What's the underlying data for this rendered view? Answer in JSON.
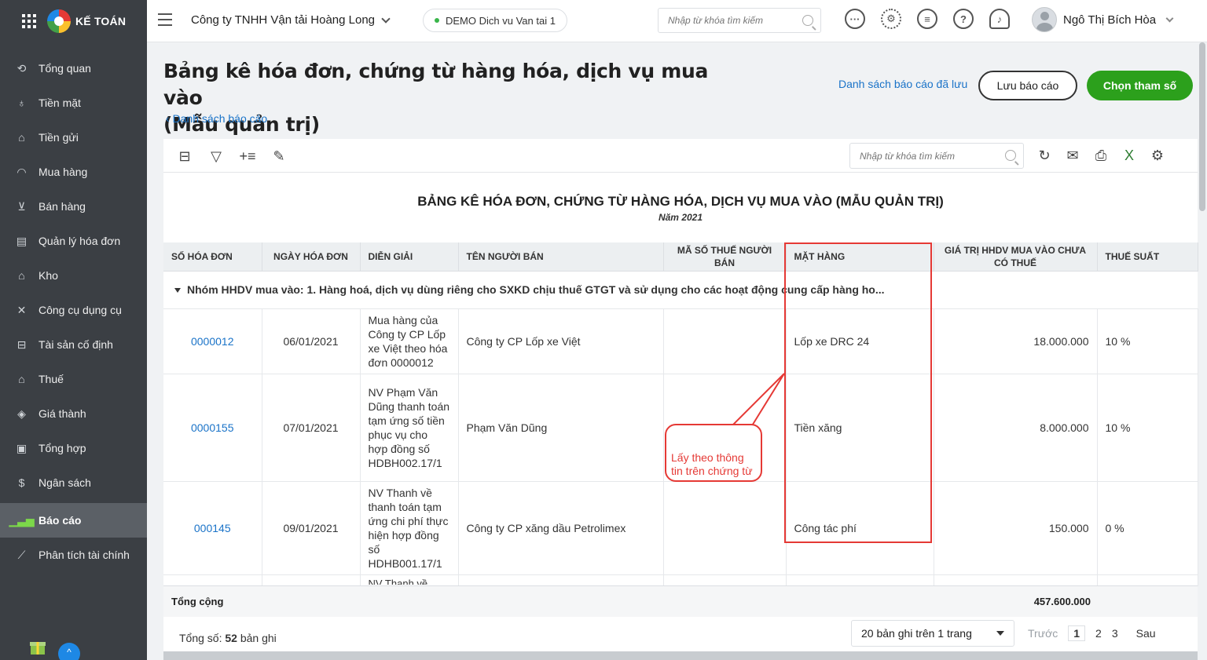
{
  "brand": {
    "name": "KẾ TOÁN"
  },
  "sidebar": {
    "items": [
      {
        "label": "Tổng quan",
        "icon": "dashboard-icon"
      },
      {
        "label": "Tiền mặt",
        "icon": "cash-icon"
      },
      {
        "label": "Tiền gửi",
        "icon": "bank-icon"
      },
      {
        "label": "Mua hàng",
        "icon": "bag-icon"
      },
      {
        "label": "Bán hàng",
        "icon": "cart-icon"
      },
      {
        "label": "Quản lý hóa đơn",
        "icon": "invoice-icon"
      },
      {
        "label": "Kho",
        "icon": "warehouse-icon"
      },
      {
        "label": "Công cụ dụng cụ",
        "icon": "tools-icon"
      },
      {
        "label": "Tài sản cố định",
        "icon": "asset-icon"
      },
      {
        "label": "Thuế",
        "icon": "tax-icon"
      },
      {
        "label": "Giá thành",
        "icon": "price-tag-icon"
      },
      {
        "label": "Tổng hợp",
        "icon": "summary-icon"
      },
      {
        "label": "Ngân sách",
        "icon": "budget-icon"
      },
      {
        "label": "Báo cáo",
        "icon": "report-bar-icon",
        "active": true
      },
      {
        "label": "Phân tích tài chính",
        "icon": "analysis-icon"
      }
    ]
  },
  "topbar": {
    "company": "Công ty TNHH Vận tải Hoàng Long",
    "demo": "DEMO Dich vu Van tai 1",
    "search_placeholder": "Nhập từ khóa tìm kiếm",
    "user": "Ngô Thị Bích Hòa"
  },
  "page": {
    "title_line1": "Bảng kê hóa đơn, chứng từ hàng hóa, dịch vụ mua vào",
    "title_line2": "(Mẫu quản trị)",
    "back_link": "Danh sách báo cáo",
    "saved_link": "Danh sách báo cáo đã lưu",
    "save_button": "Lưu báo cáo",
    "param_button": "Chọn tham số"
  },
  "toolbar": {
    "search_placeholder": "Nhập từ khóa tìm kiếm"
  },
  "report": {
    "title": "BẢNG KÊ HÓA ĐƠN, CHỨNG TỪ HÀNG HÓA, DỊCH VỤ MUA VÀO (MẪU QUẢN TRỊ)",
    "subtitle": "Năm 2021",
    "columns": {
      "invoice_no": "Số hóa đơn",
      "invoice_date": "Ngày hóa đơn",
      "description": "Diễn giải",
      "seller": "Tên người bán",
      "tax_code": "Mã số thuế người bán",
      "item": "Mặt hàng",
      "value": "Giá trị HHDV mua vào chưa có thuế",
      "tax_rate": "Thuế suất"
    },
    "group_label": "Nhóm HHDV mua vào: 1. Hàng hoá, dịch vụ dùng riêng cho SXKD chịu thuế GTGT và sử dụng cho các hoạt động cung cấp hàng ho...",
    "rows": [
      {
        "invoice_no": "0000012",
        "date": "06/01/2021",
        "description": "Mua hàng của Công ty CP Lốp xe Việt theo hóa đơn 0000012",
        "seller": "Công ty CP Lốp xe Việt",
        "tax_code": "",
        "item": "Lốp xe DRC 24",
        "value": "18.000.000",
        "rate": "10 %"
      },
      {
        "invoice_no": "0000155",
        "date": "07/01/2021",
        "description": "NV Phạm Văn Dũng thanh toán tạm ứng số tiền phục vụ cho hợp đồng số HDBH002.17/1",
        "seller": "Phạm Văn Dũng",
        "tax_code": "",
        "item": "Tiền xăng",
        "value": "8.000.000",
        "rate": "10 %"
      },
      {
        "invoice_no": "000145",
        "date": "09/01/2021",
        "description": "NV Thanh về thanh toán tạm ứng chi phí thực hiện hợp đồng số HDHB001.17/1",
        "seller": "Công ty CP xăng dầu Petrolimex",
        "tax_code": "",
        "item": "Công tác phí",
        "value": "150.000",
        "rate": "0 %"
      },
      {
        "invoice_no": "",
        "date": "",
        "description": "NV Thanh về",
        "seller": "",
        "tax_code": "",
        "item": "",
        "value": "",
        "rate": ""
      }
    ],
    "total_label": "Tổng cộng",
    "total_value": "457.600.000"
  },
  "footer": {
    "count_prefix": "Tổng số:",
    "count_value": "52",
    "count_suffix": "bản ghi",
    "page_size": "20 bản ghi trên 1 trang",
    "prev": "Trước",
    "pages": [
      "1",
      "2",
      "3"
    ],
    "next": "Sau"
  },
  "annotation": {
    "callout_line1": "Lấy theo thông",
    "callout_line2": "tin trên chứng từ",
    "color": "#e53935"
  },
  "colors": {
    "sidebar_bg": "#3b3f44",
    "accent_green": "#2ca01c",
    "link_blue": "#1a73c8"
  }
}
